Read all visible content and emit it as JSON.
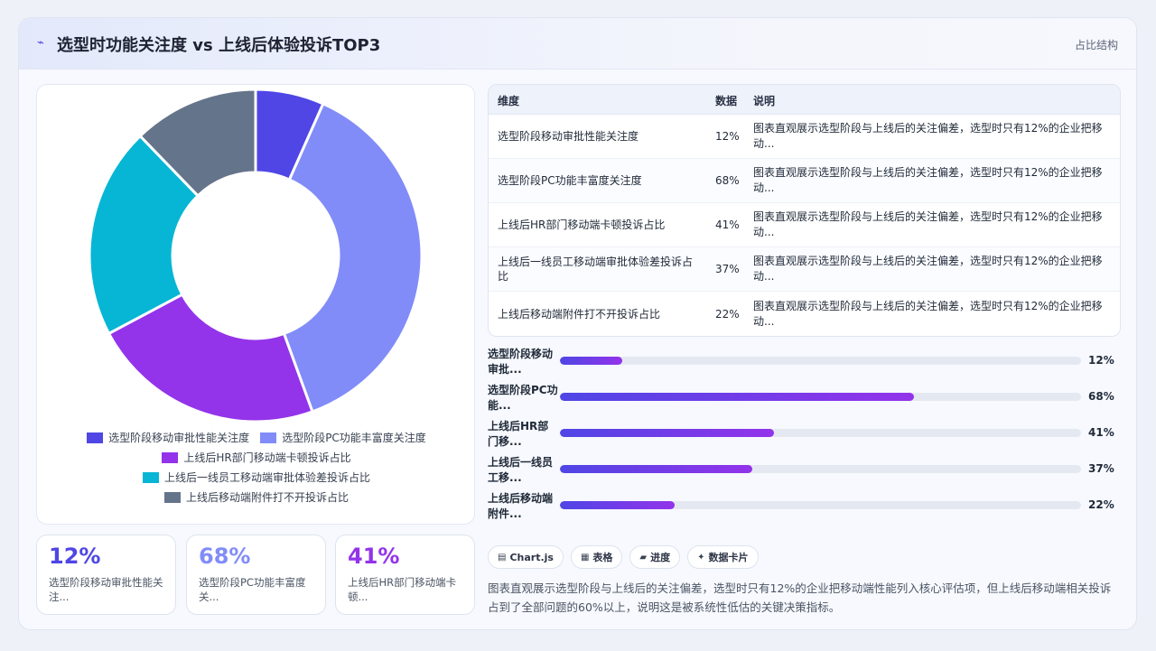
{
  "header": {
    "logo": "⌁",
    "title": "选型时功能关注度 vs 上线后体验投诉TOP3",
    "tag": "占比结构"
  },
  "chart_data": {
    "type": "pie",
    "categories": [
      "选型阶段移动审批性能关注度",
      "选型阶段PC功能丰富度关注度",
      "上线后HR部门移动端卡顿投诉占比",
      "上线后一线员工移动端审批体验差投诉占比",
      "上线后移动端附件打不开投诉占比"
    ],
    "values": [
      12,
      68,
      41,
      37,
      22
    ],
    "colors": [
      "#4f46e5",
      "#818cf8",
      "#9333ea",
      "#06b6d4",
      "#64748b"
    ],
    "legend_position": "bottom"
  },
  "stats": [
    {
      "value": "12%",
      "label": "选型阶段移动审批性能关注...",
      "color": "#4f46e5"
    },
    {
      "value": "68%",
      "label": "选型阶段PC功能丰富度关...",
      "color": "#818cf8"
    },
    {
      "value": "41%",
      "label": "上线后HR部门移动端卡顿...",
      "color": "#9333ea"
    }
  ],
  "table": {
    "headers": [
      "维度",
      "数据",
      "说明"
    ],
    "rows": [
      {
        "dim": "选型阶段移动审批性能关注度",
        "val": "12%",
        "note": "图表直观展示选型阶段与上线后的关注偏差，选型时只有12%的企业把移动..."
      },
      {
        "dim": "选型阶段PC功能丰富度关注度",
        "val": "68%",
        "note": "图表直观展示选型阶段与上线后的关注偏差，选型时只有12%的企业把移动..."
      },
      {
        "dim": "上线后HR部门移动端卡顿投诉占比",
        "val": "41%",
        "note": "图表直观展示选型阶段与上线后的关注偏差，选型时只有12%的企业把移动..."
      },
      {
        "dim": "上线后一线员工移动端审批体验差投诉占比",
        "val": "37%",
        "note": "图表直观展示选型阶段与上线后的关注偏差，选型时只有12%的企业把移动..."
      },
      {
        "dim": "上线后移动端附件打不开投诉占比",
        "val": "22%",
        "note": "图表直观展示选型阶段与上线后的关注偏差，选型时只有12%的企业把移动..."
      }
    ]
  },
  "progress": [
    {
      "label": "选型阶段移动审批...",
      "value": 12,
      "text": "12%"
    },
    {
      "label": "选型阶段PC功能...",
      "value": 68,
      "text": "68%"
    },
    {
      "label": "上线后HR部门移...",
      "value": 41,
      "text": "41%"
    },
    {
      "label": "上线后一线员工移...",
      "value": 37,
      "text": "37%"
    },
    {
      "label": "上线后移动端附件...",
      "value": 22,
      "text": "22%"
    }
  ],
  "tags": [
    {
      "icon": "▤",
      "icon_name": "chart-icon",
      "label": "Chart.js"
    },
    {
      "icon": "▦",
      "icon_name": "table-icon",
      "label": "表格"
    },
    {
      "icon": "▰",
      "icon_name": "progress-icon",
      "label": "进度"
    },
    {
      "icon": "✦",
      "icon_name": "sparkle-icon",
      "label": "数据卡片"
    }
  ],
  "summary": "图表直观展示选型阶段与上线后的关注偏差，选型时只有12%的企业把移动端性能列入核心评估项，但上线后移动端相关投诉占到了全部问题的60%以上，说明这是被系统性低估的关键决策指标。"
}
